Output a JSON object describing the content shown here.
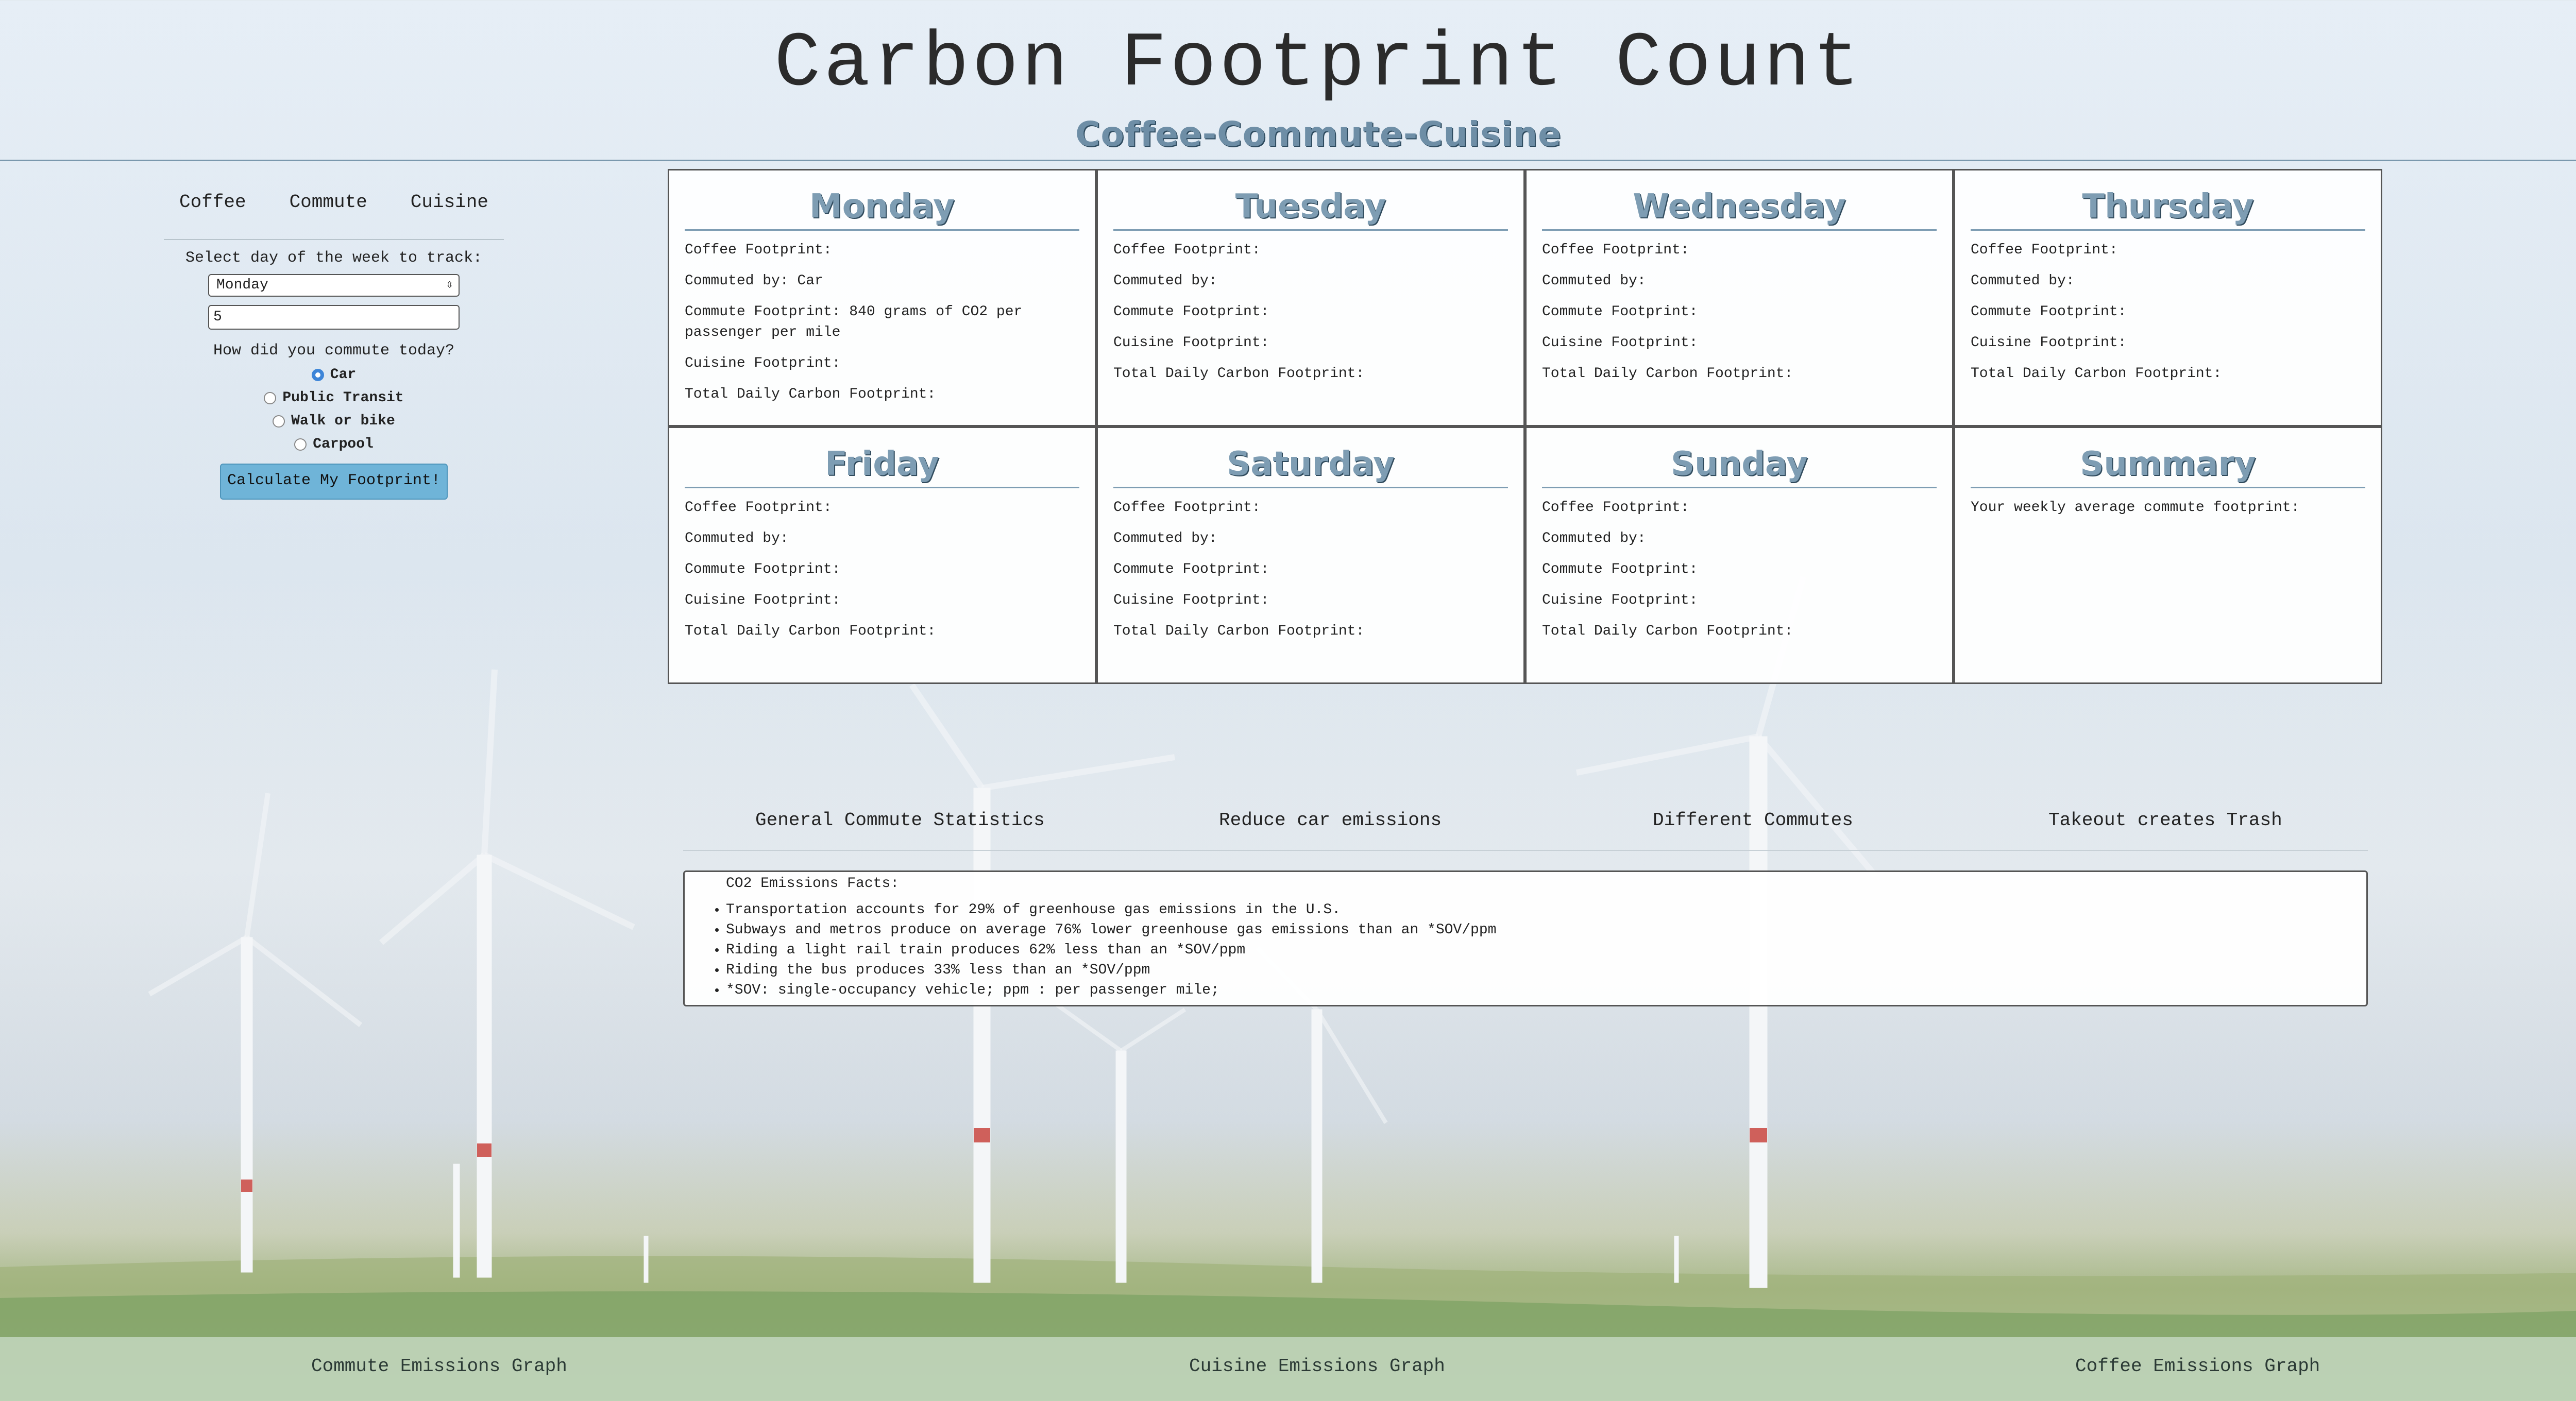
{
  "header": {
    "title": "Carbon Footprint Count",
    "subtitle": "Coffee-Commute-Cuisine"
  },
  "tracker": {
    "tabs": [
      "Coffee",
      "Commute",
      "Cuisine"
    ],
    "day_prompt": "Select day of the week to track:",
    "day_selected": "Monday",
    "input_value": "5",
    "commute_prompt": "How did you commute today?",
    "options": [
      {
        "label": "Car",
        "checked": true
      },
      {
        "label": "Public Transit",
        "checked": false
      },
      {
        "label": "Walk or bike",
        "checked": false
      },
      {
        "label": "Carpool",
        "checked": false
      }
    ],
    "button": "Calculate My Footprint!"
  },
  "days": [
    {
      "name": "Monday",
      "lines": [
        "Coffee Footprint:",
        "Commuted by: Car",
        "Commute Footprint: 840 grams of CO2 per passenger per mile",
        "Cuisine Footprint:",
        "Total Daily Carbon Footprint:"
      ]
    },
    {
      "name": "Tuesday",
      "lines": [
        "Coffee Footprint:",
        "Commuted by:",
        "Commute Footprint:",
        "Cuisine Footprint:",
        "Total Daily Carbon Footprint:"
      ]
    },
    {
      "name": "Wednesday",
      "lines": [
        "Coffee Footprint:",
        "Commuted by:",
        "Commute Footprint:",
        "Cuisine Footprint:",
        "Total Daily Carbon Footprint:"
      ]
    },
    {
      "name": "Thursday",
      "lines": [
        "Coffee Footprint:",
        "Commuted by:",
        "Commute Footprint:",
        "Cuisine Footprint:",
        "Total Daily Carbon Footprint:"
      ]
    },
    {
      "name": "Friday",
      "lines": [
        "Coffee Footprint:",
        "Commuted by:",
        "Commute Footprint:",
        "Cuisine Footprint:",
        "Total Daily Carbon Footprint:"
      ]
    },
    {
      "name": "Saturday",
      "lines": [
        "Coffee Footprint:",
        "Commuted by:",
        "Commute Footprint:",
        "Cuisine Footprint:",
        "Total Daily Carbon Footprint:"
      ]
    },
    {
      "name": "Sunday",
      "lines": [
        "Coffee Footprint:",
        "Commuted by:",
        "Commute Footprint:",
        "Cuisine Footprint:",
        "Total Daily Carbon Footprint:"
      ]
    },
    {
      "name": "Summary",
      "lines": [
        "Your weekly average commute footprint:"
      ]
    }
  ],
  "info": {
    "tabs": [
      "General Commute Statistics",
      "Reduce car emissions",
      "Different Commutes",
      "Takeout creates Trash"
    ],
    "facts_heading": "CO2 Emissions Facts:",
    "facts": [
      "Transportation accounts for 29% of greenhouse gas emissions in the U.S.",
      "Subways and metros produce on average 76% lower greenhouse gas emissions than an *SOV/ppm",
      "Riding a light rail train produces 62% less than an *SOV/ppm",
      "Riding the bus produces 33% less than an *SOV/ppm",
      "*SOV: single-occupancy vehicle; ppm : per passenger mile;"
    ]
  },
  "footer": {
    "links": [
      "Commute Emissions Graph",
      "Cuisine Emissions Graph",
      "Coffee Emissions Graph"
    ]
  }
}
